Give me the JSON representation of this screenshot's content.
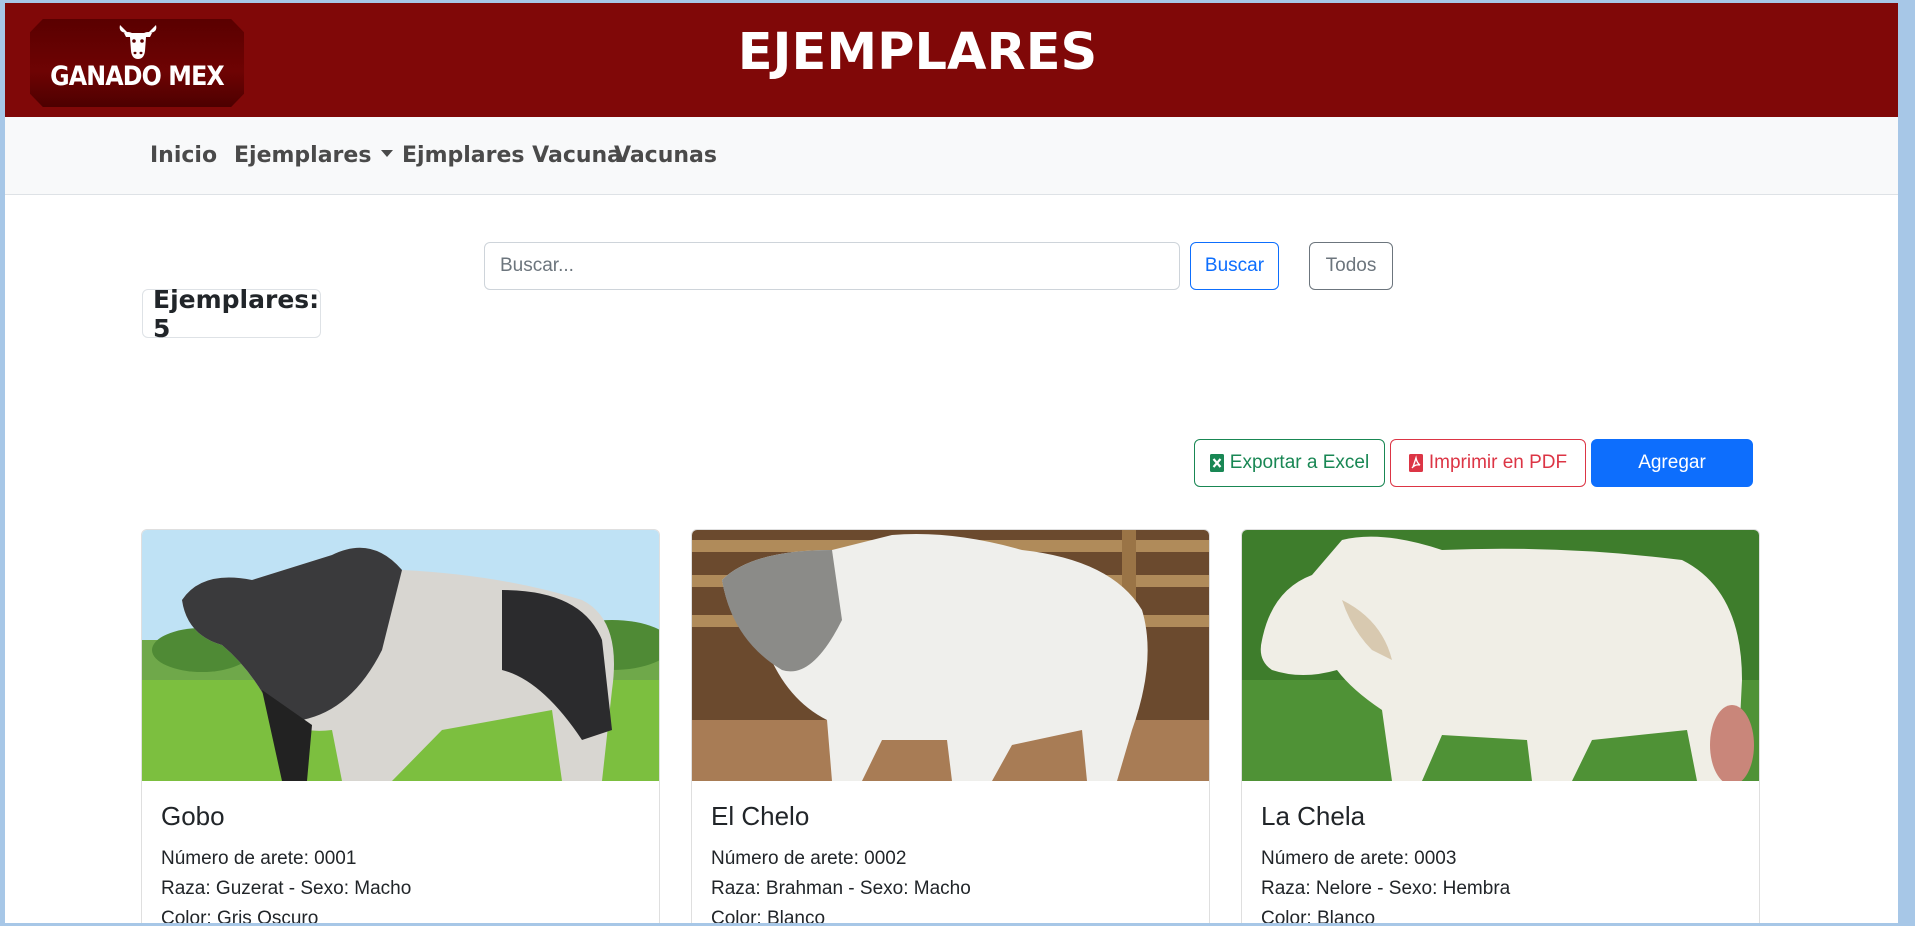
{
  "header": {
    "logo_text": "GANADO MEX",
    "title": "EJEMPLARES",
    "bg_color": "#800808"
  },
  "nav": {
    "items": [
      {
        "label": "Inicio"
      },
      {
        "label": "Ejemplares",
        "dropdown": true
      },
      {
        "label": "Ejmplares Vacuna"
      },
      {
        "label": "Vacunas"
      }
    ]
  },
  "search": {
    "placeholder": "Buscar...",
    "value": "",
    "buscar_label": "Buscar",
    "todos_label": "Todos"
  },
  "count": {
    "label": "Ejemplares: 5"
  },
  "actions": {
    "excel_label": "Exportar a Excel",
    "excel_icon": "file-excel-icon",
    "pdf_label": "Imprimir en PDF",
    "pdf_icon": "file-pdf-icon",
    "add_label": "Agregar"
  },
  "colors": {
    "primary": "#0d6efd",
    "success": "#198754",
    "danger": "#dc3545",
    "secondary": "#6c757d"
  },
  "cards": [
    {
      "name": "Gobo",
      "arete": "Número de arete: 0001",
      "raza_sexo": "Raza: Guzerat - Sexo: Macho",
      "color": "Color: Gris Oscuro"
    },
    {
      "name": "El Chelo",
      "arete": "Número de arete: 0002",
      "raza_sexo": "Raza: Brahman - Sexo: Macho",
      "color": "Color: Blanco"
    },
    {
      "name": "La Chela",
      "arete": "Número de arete: 0003",
      "raza_sexo": "Raza: Nelore - Sexo: Hembra",
      "color": "Color: Blanco"
    }
  ]
}
